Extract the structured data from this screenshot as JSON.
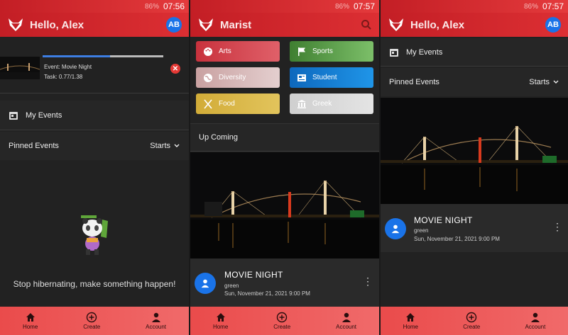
{
  "status": {
    "left_clock": "07:56",
    "mid_clock": "07:57",
    "right_clock": "07:57",
    "battery": "86%"
  },
  "screen1": {
    "title": "Hello, Alex",
    "avatar": "AB",
    "upload": {
      "event_label": "Event: Movie Night",
      "task_label": "Task: 0.77/1.38",
      "progress": 0.558
    },
    "my_events": "My Events",
    "pinned": "Pinned Events",
    "sort": "Starts",
    "empty_message": "Stop hibernating, make something happen!"
  },
  "screen2": {
    "title": "Marist",
    "categories": [
      {
        "label": "Arts",
        "icon": "palette-icon",
        "color": "#c8323d"
      },
      {
        "label": "Sports",
        "icon": "flag-icon",
        "color": "#4a8b3a"
      },
      {
        "label": "Diversity",
        "icon": "globe-icon",
        "color": "#cfa7a7"
      },
      {
        "label": "Student",
        "icon": "newspaper-icon",
        "color": "#1275c9"
      },
      {
        "label": "Food",
        "icon": "utensils-icon",
        "color": "#d4b13f"
      },
      {
        "label": "Greek",
        "icon": "columns-icon",
        "color": "#d6d6d6"
      }
    ],
    "upcoming": "Up Coming",
    "event": {
      "title": "MOVIE NIGHT",
      "subtitle": "green",
      "date": "Sun, November 21, 2021 9:00 PM"
    }
  },
  "screen3": {
    "title": "Hello, Alex",
    "avatar": "AB",
    "my_events": "My Events",
    "pinned": "Pinned Events",
    "sort": "Starts",
    "event": {
      "title": "MOVIE NIGHT",
      "subtitle": "green",
      "date": "Sun, November 21, 2021 9:00 PM"
    }
  },
  "nav": {
    "home": "Home",
    "create": "Create",
    "account": "Account"
  },
  "colors": {
    "brand_red": "#d1262c",
    "accent_blue": "#1a73e8",
    "nav_red": "#ee5b5b"
  }
}
